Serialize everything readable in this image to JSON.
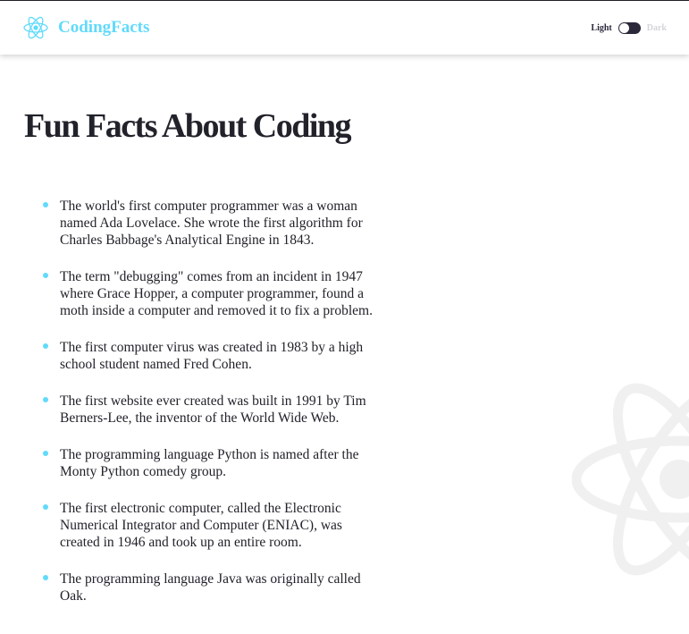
{
  "navbar": {
    "brand_title": "CodingFacts",
    "logo_icon": "react-atom-icon",
    "accent_color": "#61dafb",
    "toggler": {
      "light_label": "Light",
      "dark_label": "Dark",
      "mode": "light"
    }
  },
  "main": {
    "title": "Fun Facts About Coding",
    "background_icon": "react-atom-icon",
    "facts": [
      "The world's first computer programmer was a woman named Ada Lovelace. She wrote the first algorithm for Charles Babbage's Analytical Engine in 1843.",
      "The term \"debugging\" comes from an incident in 1947 where Grace Hopper, a computer programmer, found a moth inside a computer and removed it to fix a problem.",
      "The first computer virus was created in 1983 by a high school student named Fred Cohen.",
      "The first website ever created was built in 1991 by Tim Berners-Lee, the inventor of the World Wide Web.",
      "The programming language Python is named after the Monty Python comedy group.",
      "The first electronic computer, called the Electronic Numerical Integrator and Computer (ENIAC), was created in 1946 and took up an entire room.",
      "The programming language Java was originally called Oak."
    ]
  }
}
